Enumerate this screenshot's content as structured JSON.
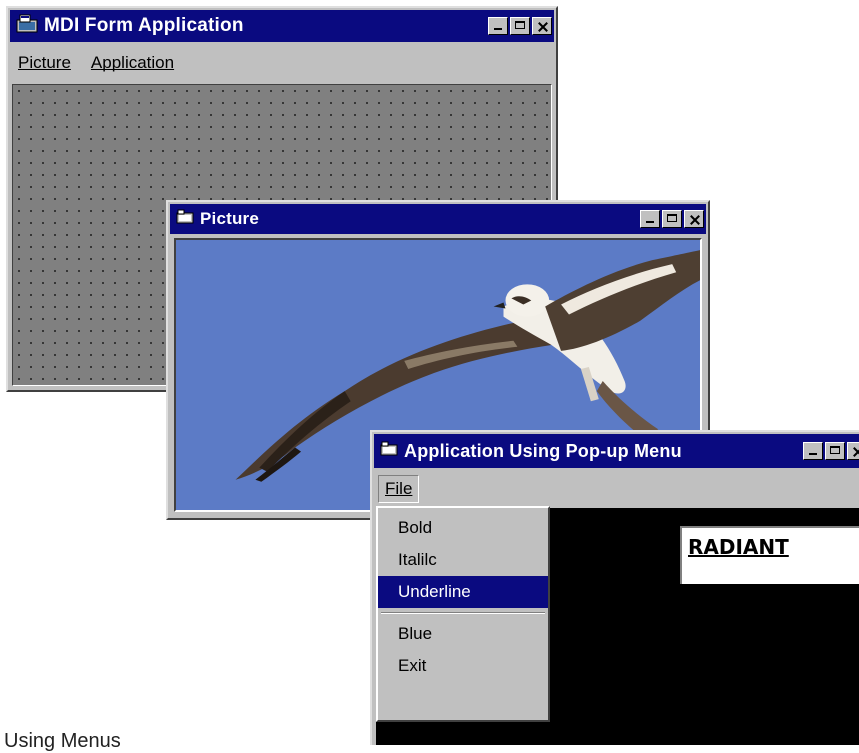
{
  "mdi_window": {
    "title": "MDI Form Application",
    "menu": [
      {
        "label": "Picture"
      },
      {
        "label": "Application"
      }
    ]
  },
  "picture_window": {
    "title": "Picture",
    "image_icon": "osprey-in-flight-image"
  },
  "popup_app_window": {
    "title": "Application Using Pop-up Menu",
    "menu": [
      {
        "label": "File"
      }
    ],
    "popup_menu": [
      {
        "label": "Bold",
        "selected": false
      },
      {
        "label": "Italilc",
        "selected": false
      },
      {
        "label": "Underline",
        "selected": true
      },
      {
        "label": "Blue",
        "selected": false
      },
      {
        "label": "Exit",
        "selected": false
      }
    ],
    "display_text": "RADIANT"
  },
  "caption": "Using Menus",
  "colors": {
    "title_bar": "#0a0a80",
    "face": "#c0c0c0",
    "mdi_background": "#808080",
    "sky": "#5c7bc6",
    "canvas": "#000000",
    "selection": "#0a0a80"
  }
}
